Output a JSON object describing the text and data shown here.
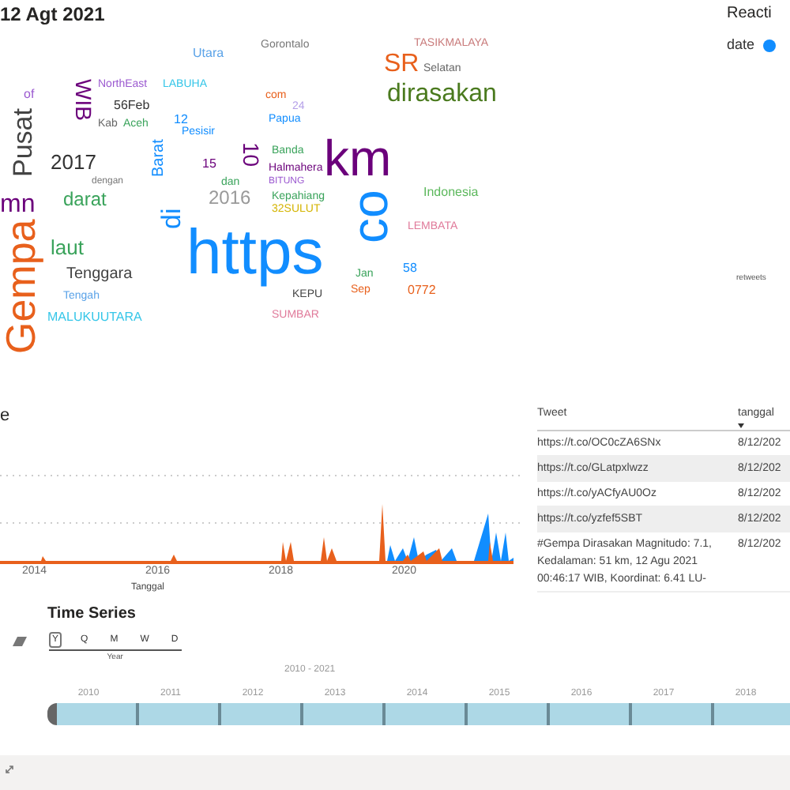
{
  "header": {
    "title": "12 Agt 2021"
  },
  "word_cloud": {
    "words": [
      {
        "text": "Gorontalo",
        "color": "#777777"
      },
      {
        "text": "Utara",
        "color": "#5ba3e8"
      },
      {
        "text": "TASIKMALAYA",
        "color": "#c97b7b"
      },
      {
        "text": "SR",
        "color": "#e8601c"
      },
      {
        "text": "Selatan",
        "color": "#666666"
      },
      {
        "text": "NorthEast",
        "color": "#9b59d0"
      },
      {
        "text": "LABUHA",
        "color": "#35c6e8"
      },
      {
        "text": "WIB",
        "color": "#6b007b"
      },
      {
        "text": "of",
        "color": "#9b59d0"
      },
      {
        "text": "com",
        "color": "#e8601c"
      },
      {
        "text": "56Feb",
        "color": "#333333"
      },
      {
        "text": "24",
        "color": "#b49fe8"
      },
      {
        "text": "dirasakan",
        "color": "#4a7a1e"
      },
      {
        "text": "12",
        "color": "#118dff"
      },
      {
        "text": "Kab",
        "color": "#666666"
      },
      {
        "text": "Aceh",
        "color": "#3aa35b"
      },
      {
        "text": "Papua",
        "color": "#118dff"
      },
      {
        "text": "Pesisir",
        "color": "#118dff"
      },
      {
        "text": "10",
        "color": "#6b007b"
      },
      {
        "text": "Banda",
        "color": "#3aa35b"
      },
      {
        "text": "2017",
        "color": "#333333"
      },
      {
        "text": "15",
        "color": "#6b007b"
      },
      {
        "text": "Halmahera",
        "color": "#6b007b"
      },
      {
        "text": "Pusat",
        "color": "#444444"
      },
      {
        "text": "dengan",
        "color": "#777777"
      },
      {
        "text": "Barat",
        "color": "#118dff"
      },
      {
        "text": "dan",
        "color": "#3aa35b"
      },
      {
        "text": "BITUNG",
        "color": "#9b59d0"
      },
      {
        "text": "km",
        "color": "#6b007b"
      },
      {
        "text": "2016",
        "color": "#999999"
      },
      {
        "text": "Indonesia",
        "color": "#5cb85c"
      },
      {
        "text": "darat",
        "color": "#3aa35b"
      },
      {
        "text": "Kepahiang",
        "color": "#3aa35b"
      },
      {
        "text": "mn",
        "color": "#6b007b"
      },
      {
        "text": "32SULUT",
        "color": "#d4b400"
      },
      {
        "text": "co",
        "color": "#118dff"
      },
      {
        "text": "https",
        "color": "#118dff"
      },
      {
        "text": "di",
        "color": "#118dff"
      },
      {
        "text": "LEMBATA",
        "color": "#e07a9a"
      },
      {
        "text": "KEPU",
        "color": "#444444"
      },
      {
        "text": "laut",
        "color": "#3aa35b"
      },
      {
        "text": "Gempa",
        "color": "#e8601c"
      },
      {
        "text": "58",
        "color": "#118dff"
      },
      {
        "text": "Tenggara",
        "color": "#444444"
      },
      {
        "text": "Jan",
        "color": "#3aa35b"
      },
      {
        "text": "Sep",
        "color": "#e8601c"
      },
      {
        "text": "0772",
        "color": "#e8601c"
      },
      {
        "text": "Tengah",
        "color": "#5ba3e8"
      },
      {
        "text": "SUMBAR",
        "color": "#e07a9a"
      },
      {
        "text": "MALUKUUTARA",
        "color": "#35c6e8"
      }
    ]
  },
  "legend": {
    "title": "Reacti",
    "items": [
      {
        "label": "date",
        "color": "#118dff"
      }
    ]
  },
  "side_label": "retweets",
  "time_chart": {
    "title": "e",
    "xticks": [
      "2014",
      "2016",
      "2018",
      "2020"
    ],
    "xlabel": "Tanggal"
  },
  "table": {
    "columns": [
      {
        "label": "Tweet",
        "sorted": false
      },
      {
        "label": "tanggal",
        "sorted": true
      }
    ],
    "rows": [
      {
        "tweet": "https://t.co/OC0cZA6SNx",
        "date": "8/12/202"
      },
      {
        "tweet": "https://t.co/GLatpxlwzz",
        "date": "8/12/202"
      },
      {
        "tweet": "https://t.co/yACfyAU0Oz",
        "date": "8/12/202"
      },
      {
        "tweet": "https://t.co/yzfef5SBT",
        "date": "8/12/202"
      },
      {
        "tweet": "#Gempa Dirasakan Magnitudo: 7.1, Kedalaman: 51 km, 12 Agu 2021 00:46:17 WIB, Koordinat: 6.41 LU-",
        "date": "8/12/202"
      }
    ]
  },
  "time_series": {
    "title": "Time Series",
    "granularity": [
      {
        "label": "Y",
        "selected": true
      },
      {
        "label": "Q",
        "selected": false
      },
      {
        "label": "M",
        "selected": false
      },
      {
        "label": "W",
        "selected": false
      },
      {
        "label": "D",
        "selected": false
      }
    ],
    "granularity_label": "Year",
    "range": "2010 - 2021",
    "years": [
      "2010",
      "2011",
      "2012",
      "2013",
      "2014",
      "2015",
      "2016",
      "2017",
      "2018"
    ]
  }
}
